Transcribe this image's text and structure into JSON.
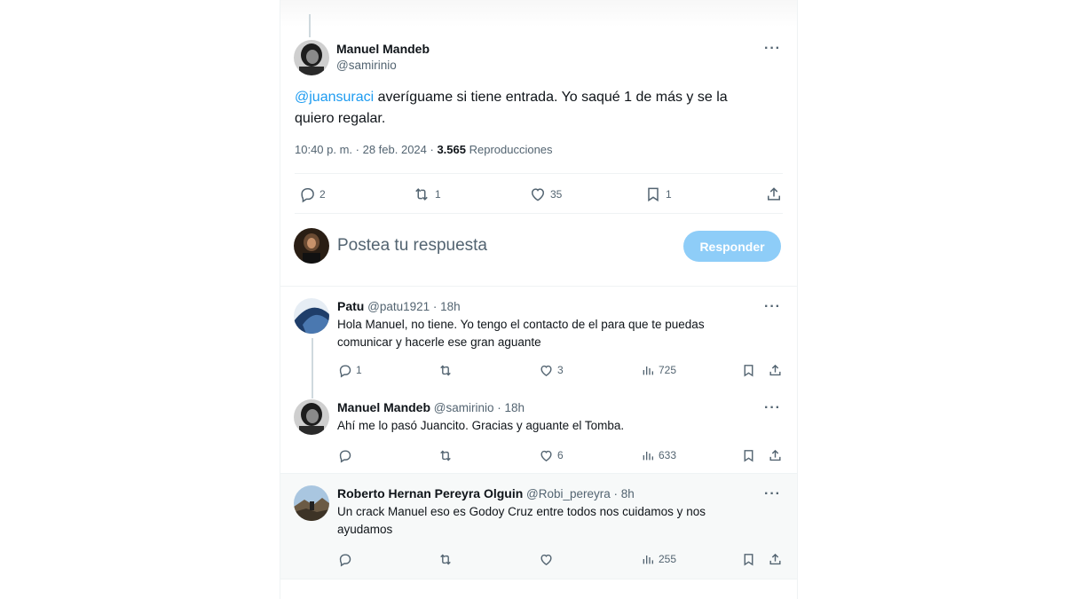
{
  "main_tweet": {
    "author_name": "Manuel Mandeb",
    "author_handle": "@samirinio",
    "mention": "@juansuraci",
    "text": " averíguame si tiene entrada. Yo saqué 1 de más y se la quiero regalar.",
    "timestamp": "10:40 p. m. · 28 feb. 2024 · ",
    "views_count": "3.565",
    "views_label": " Reproducciones",
    "more": "···",
    "stats": {
      "replies": "2",
      "retweets": "1",
      "likes": "35",
      "bookmarks": "1"
    }
  },
  "compose": {
    "placeholder": "Postea tu respuesta",
    "button": "Responder"
  },
  "replies": [
    {
      "name": "Patu",
      "handle_time": "@patu1921 · 18h",
      "text": "Hola  Manuel, no tiene. Yo tengo el contacto de el para que te puedas comunicar y hacerle ese gran aguante",
      "stats": {
        "replies": "1",
        "retweets": "",
        "likes": "3",
        "views": "725"
      }
    },
    {
      "name": "Manuel Mandeb",
      "handle_time": "@samirinio · 18h",
      "text": "Ahí me lo pasó Juancito. Gracias y aguante el Tomba.",
      "stats": {
        "replies": "",
        "retweets": "",
        "likes": "6",
        "views": "633"
      }
    },
    {
      "name": "Roberto Hernan Pereyra Olguin",
      "handle_time": "@Robi_pereyra · 8h",
      "text": "Un crack Manuel eso es Godoy Cruz entre todos nos cuidamos y nos ayudamos",
      "stats": {
        "replies": "",
        "retweets": "",
        "likes": "",
        "views": "255"
      }
    }
  ],
  "colors": {
    "accent": "#1d9bf0",
    "muted": "#536471",
    "reply_button": "#8ecdf8"
  },
  "icons": [
    "reply-icon",
    "retweet-icon",
    "like-icon",
    "bookmark-icon",
    "share-icon",
    "views-icon",
    "more-icon"
  ]
}
